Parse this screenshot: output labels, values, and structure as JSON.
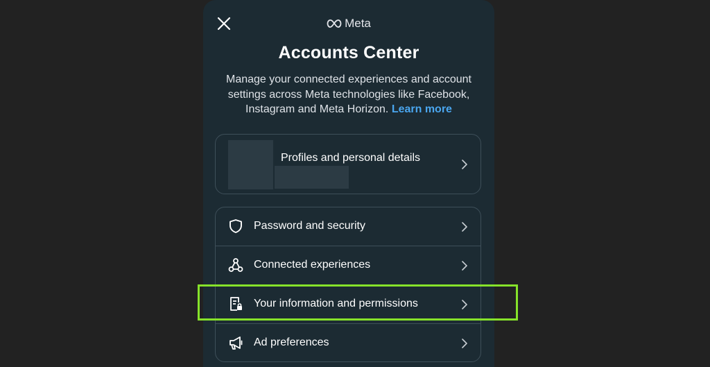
{
  "header": {
    "brand": "Meta",
    "title": "Accounts Center"
  },
  "description": {
    "text": "Manage your connected experiences and account settings across Meta technologies like Facebook, Instagram and Meta Horizon.",
    "link": "Learn more"
  },
  "profile_card": {
    "label": "Profiles and personal details"
  },
  "settings": {
    "items": [
      {
        "label": "Password and security",
        "icon": "shield-icon"
      },
      {
        "label": "Connected experiences",
        "icon": "connected-icon"
      },
      {
        "label": "Your information and permissions",
        "icon": "info-permissions-icon"
      },
      {
        "label": "Ad preferences",
        "icon": "megaphone-icon"
      }
    ]
  },
  "colors": {
    "background": "#222222",
    "panel": "#1c2b33",
    "link": "#4aa6ef",
    "highlight": "#86e32a"
  }
}
